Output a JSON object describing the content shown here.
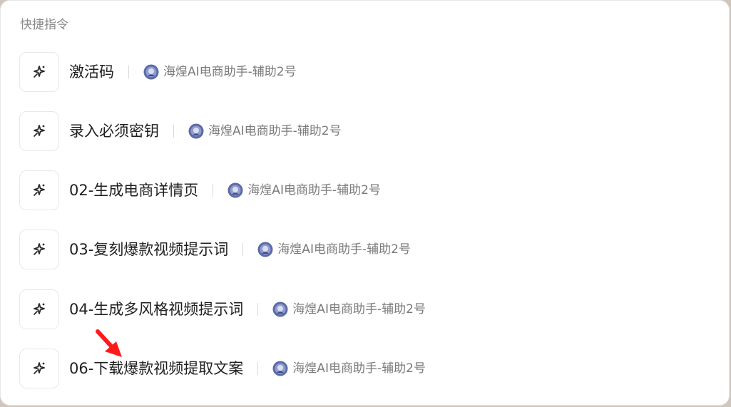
{
  "panel": {
    "section_title": "快捷指令"
  },
  "items": [
    {
      "title": "激活码",
      "icon": "sparkle-magic-icon",
      "source": "海煌AI电商助手-辅助2号",
      "source_icon": "bot-avatar-icon"
    },
    {
      "title": "录入必须密钥",
      "icon": "sparkle-magic-icon",
      "source": "海煌AI电商助手-辅助2号",
      "source_icon": "bot-avatar-icon"
    },
    {
      "title": "02-生成电商详情页",
      "icon": "sparkle-magic-icon",
      "source": "海煌AI电商助手-辅助2号",
      "source_icon": "bot-avatar-icon"
    },
    {
      "title": "03-复刻爆款视频提示词",
      "icon": "sparkle-magic-icon",
      "source": "海煌AI电商助手-辅助2号",
      "source_icon": "bot-avatar-icon"
    },
    {
      "title": "04-生成多风格视频提示词",
      "icon": "sparkle-magic-icon",
      "source": "海煌AI电商助手-辅助2号",
      "source_icon": "bot-avatar-icon"
    },
    {
      "title": "06-下载爆款视频提取文案",
      "icon": "sparkle-magic-icon",
      "source": "海煌AI电商助手-辅助2号",
      "source_icon": "bot-avatar-icon"
    }
  ],
  "colors": {
    "annotation_arrow": "#ff1a1a",
    "text_primary": "#1f1f1f",
    "text_secondary": "#7a7a7a"
  }
}
